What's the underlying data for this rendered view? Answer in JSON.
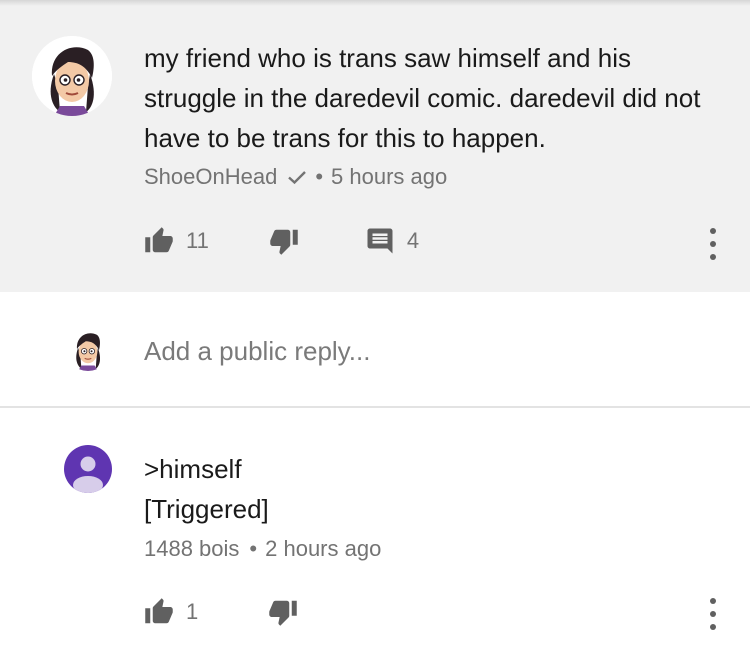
{
  "comment": {
    "text": "my friend who is trans saw himself and his struggle in the daredevil comic. daredevil did not have to be trans for this to happen.",
    "author": "ShoeOnHead",
    "time": "5 hours ago",
    "likes": "11",
    "replies": "4",
    "verified_icon": "checkmark-icon"
  },
  "reply_box": {
    "placeholder": "Add a public reply..."
  },
  "reply": {
    "line1": ">himself",
    "line2": "[Triggered]",
    "author": "1488 bois",
    "time": "2 hours ago",
    "likes": "1"
  },
  "colors": {
    "card_background": "#f1f1f1",
    "text": "#1a1a1a",
    "meta": "#737373",
    "icon": "#606060",
    "default_avatar": "#5f35b1"
  },
  "separator": "•"
}
